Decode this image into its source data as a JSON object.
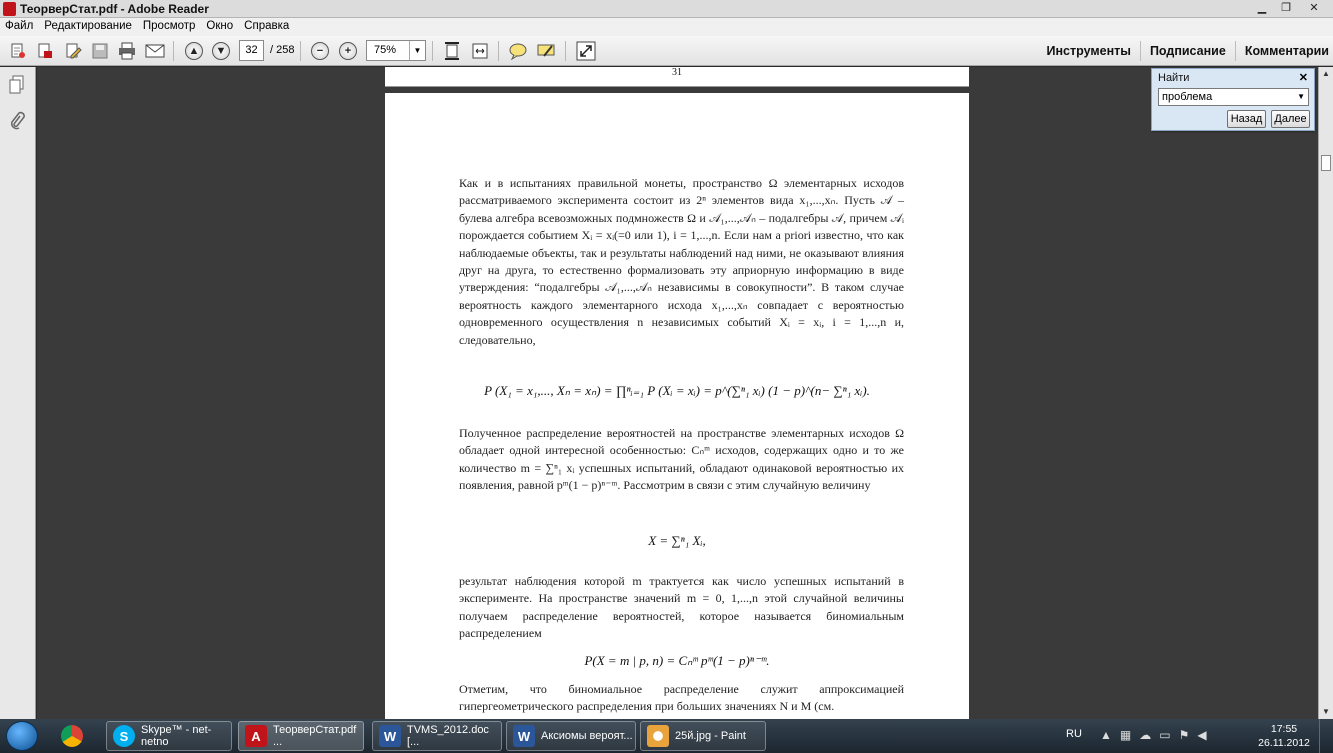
{
  "window": {
    "title": "ТеорверСтат.pdf - Adobe Reader"
  },
  "menu": [
    "Файл",
    "Редактирование",
    "Просмотр",
    "Окно",
    "Справка"
  ],
  "toolbar": {
    "page_current": "32",
    "page_total": "/ 258",
    "zoom": "75%",
    "right_tools": [
      "Инструменты",
      "Подписание",
      "Комментарии"
    ]
  },
  "document": {
    "prev_page_number": "31",
    "paragraph1": "Как и в испытаниях правильной монеты, пространство Ω элементарных исходов рассматриваемого эксперимента состоит из 2ⁿ элементов вида x₁,...,xₙ. Пусть 𝒜 – булева алгебра всевозможных подмножеств Ω и 𝒜₁,...,𝒜ₙ – подалгебры 𝒜, причем 𝒜ᵢ порождается событием Xᵢ = xᵢ(=0 или 1), i = 1,...,n. Если нам a priori известно, что как наблюдаемые объекты, так и результаты наблюдений над ними, не оказывают влияния друг на друга, то естественно формализовать эту априорную информацию в виде утверждения: “подалгебры 𝒜₁,...,𝒜ₙ независимы в совокупности”. В таком случае вероятность каждого элементарного исхода x₁,...,xₙ совпадает с вероятностью одновременного осуществления n независимых событий Xᵢ = xᵢ, i = 1,...,n и, следовательно,",
    "formula1": "P (X₁ = x₁,..., Xₙ = xₙ) = ∏ⁿᵢ₌₁ P (Xᵢ = xᵢ) = p^(∑ⁿ₁ xᵢ) (1 − p)^(n− ∑ⁿ₁ xᵢ).",
    "paragraph2": "Полученное распределение вероятностей на пространстве элементарных исходов Ω обладает одной интересной особенностью: Cₙᵐ исходов, содержащих одно и то же количество m = ∑ⁿ₁ xᵢ успешных испытаний, обладают одинаковой вероятностью их появления, равной pᵐ(1 − p)ⁿ⁻ᵐ. Рассмотрим в связи с этим случайную величину",
    "formula2": "X = ∑ⁿ₁ Xᵢ,",
    "paragraph3": "результат наблюдения которой m трактуется как число успешных испытаний в эксперименте. На пространстве значений m = 0, 1,...,n этой случайной величины получаем распределение вероятностей, которое называется биномиальным распределением",
    "formula3": "P(X = m | p, n) = Cₙᵐ pᵐ(1 − p)ⁿ⁻ᵐ.",
    "paragraph4": "Отметим, что биномиальное распределение служит аппроксимацией гипергеометрического распределения при больших значениях N и M (см."
  },
  "find_panel": {
    "title": "Найти",
    "query": "проблема",
    "back_label": "Назад",
    "next_label": "Далее"
  },
  "taskbar": {
    "apps": [
      {
        "label": "Skype™ - net-netno"
      },
      {
        "label": "ТеорверСтат.pdf ..."
      },
      {
        "label": "TVMS_2012.doc [..."
      },
      {
        "label": "Аксиомы вероят..."
      },
      {
        "label": "25й.jpg - Paint"
      }
    ],
    "language": "RU",
    "time": "17:55",
    "date": "26.11.2012"
  },
  "colors": {
    "reader_red": "#c0141a",
    "taskbar": "#24313c",
    "find_panel": "#d9e7f4"
  }
}
